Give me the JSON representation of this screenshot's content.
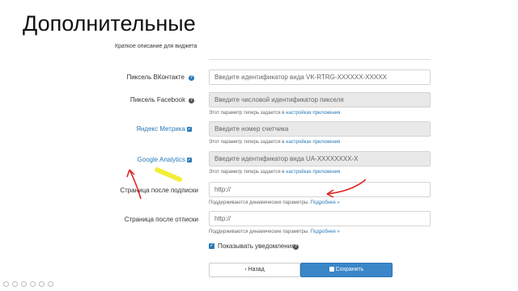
{
  "page": {
    "title": "Дополнительные"
  },
  "form": {
    "description_label": "Краткое описание для виджета",
    "vk_pixel": {
      "label": "Пиксель ВКонтакте",
      "placeholder": "Введите идентификатор вида VK-RTRG-XXXXXX-XXXXX"
    },
    "facebook_pixel": {
      "label": "Пиксель Facebook",
      "placeholder": "Введите числовой идентификатор пикселя",
      "hint": "Этот параметр теперь задается в",
      "hint_link": "настройках приложения"
    },
    "yandex_metrika": {
      "label": "Яндекс Метрика",
      "placeholder": "Введите номер счетчика",
      "hint": "Этот параметр теперь задается в",
      "hint_link": "настройках приложения"
    },
    "google_analytics": {
      "label": "Google Analytics",
      "placeholder": "Введите идентификатор вида UA-XXXXXXXX-X",
      "hint": "Этот параметр теперь задается в",
      "hint_link": "настройках приложения"
    },
    "after_subscribe": {
      "label": "Страница после подписки",
      "value": "http://",
      "hint": "Поддерживаются динамические параметры.",
      "hint_link": "Подробнее »"
    },
    "after_unsubscribe": {
      "label": "Страница после отписки",
      "value": "http://",
      "hint": "Поддерживаются динамические параметры.",
      "hint_link": "Подробнее »"
    },
    "show_notifications": {
      "label": "Показывать уведомления",
      "checked": true
    }
  },
  "buttons": {
    "back": "‹ Назад",
    "save": "Сохранить"
  },
  "colors": {
    "accent": "#3a86c8",
    "link": "#2a7ab8",
    "annotation_red": "#e02020",
    "annotation_yellow": "#f2ee3a"
  },
  "icons": [
    "help-icon",
    "external-link-icon",
    "checkbox-icon",
    "save-icon"
  ]
}
